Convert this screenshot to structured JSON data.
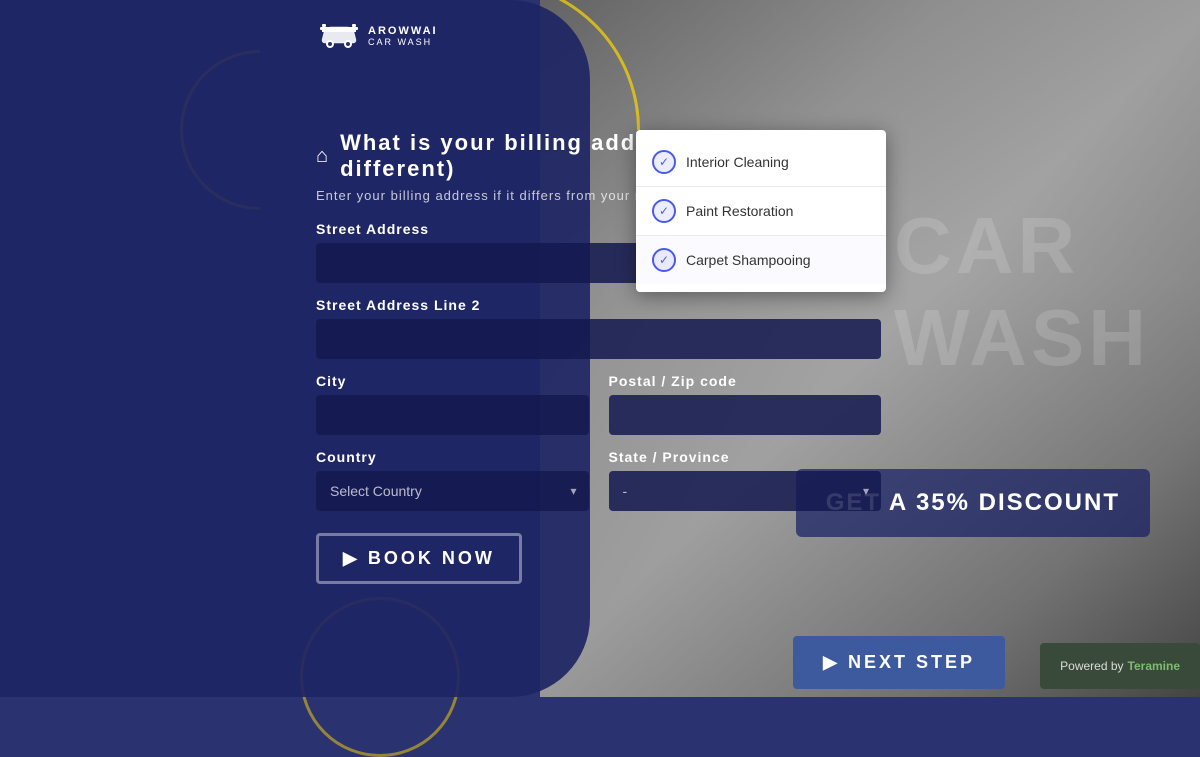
{
  "brand": {
    "name": "AROWWAI",
    "tagline": "CAR WASH",
    "icon_label": "car-icon"
  },
  "form": {
    "title": "What is your billing address? (if different)",
    "subtitle": "Enter your billing address if it differs from your residential address.",
    "fields": {
      "street_address_label": "Street Address",
      "street_address_line2_label": "Street Address Line 2",
      "city_label": "City",
      "postal_label": "Postal / Zip code",
      "country_label": "Country",
      "state_label": "State / Province",
      "country_placeholder": "Select Country",
      "state_placeholder": "-"
    }
  },
  "dropdown_items": [
    {
      "label": "Interior Cleaning",
      "checked": true
    },
    {
      "label": "Paint Restoration",
      "checked": true
    },
    {
      "label": "Carpet Shampooing",
      "checked": true
    }
  ],
  "buttons": {
    "book_now": "BOOK NOW",
    "next_step": "Next  Step",
    "next_step_arrow": "▶",
    "arrow": "▶"
  },
  "powered_by": {
    "label": "Powered by",
    "brand": "Teramine"
  },
  "icons": {
    "home": "⌂",
    "info": "i",
    "chevron_down": "▾",
    "arrow_right": "▶",
    "checkmark": "✓"
  },
  "discount": {
    "text": "GET A 35% DISCOUNT"
  }
}
